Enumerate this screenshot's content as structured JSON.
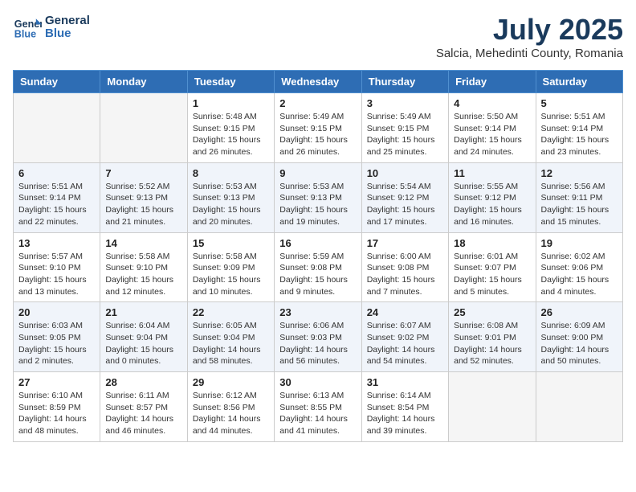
{
  "header": {
    "logo_line1": "General",
    "logo_line2": "Blue",
    "month": "July 2025",
    "location": "Salcia, Mehedinti County, Romania"
  },
  "weekdays": [
    "Sunday",
    "Monday",
    "Tuesday",
    "Wednesday",
    "Thursday",
    "Friday",
    "Saturday"
  ],
  "weeks": [
    [
      {
        "day": "",
        "sunrise": "",
        "sunset": "",
        "daylight": ""
      },
      {
        "day": "",
        "sunrise": "",
        "sunset": "",
        "daylight": ""
      },
      {
        "day": "1",
        "sunrise": "Sunrise: 5:48 AM",
        "sunset": "Sunset: 9:15 PM",
        "daylight": "Daylight: 15 hours and 26 minutes."
      },
      {
        "day": "2",
        "sunrise": "Sunrise: 5:49 AM",
        "sunset": "Sunset: 9:15 PM",
        "daylight": "Daylight: 15 hours and 26 minutes."
      },
      {
        "day": "3",
        "sunrise": "Sunrise: 5:49 AM",
        "sunset": "Sunset: 9:15 PM",
        "daylight": "Daylight: 15 hours and 25 minutes."
      },
      {
        "day": "4",
        "sunrise": "Sunrise: 5:50 AM",
        "sunset": "Sunset: 9:14 PM",
        "daylight": "Daylight: 15 hours and 24 minutes."
      },
      {
        "day": "5",
        "sunrise": "Sunrise: 5:51 AM",
        "sunset": "Sunset: 9:14 PM",
        "daylight": "Daylight: 15 hours and 23 minutes."
      }
    ],
    [
      {
        "day": "6",
        "sunrise": "Sunrise: 5:51 AM",
        "sunset": "Sunset: 9:14 PM",
        "daylight": "Daylight: 15 hours and 22 minutes."
      },
      {
        "day": "7",
        "sunrise": "Sunrise: 5:52 AM",
        "sunset": "Sunset: 9:13 PM",
        "daylight": "Daylight: 15 hours and 21 minutes."
      },
      {
        "day": "8",
        "sunrise": "Sunrise: 5:53 AM",
        "sunset": "Sunset: 9:13 PM",
        "daylight": "Daylight: 15 hours and 20 minutes."
      },
      {
        "day": "9",
        "sunrise": "Sunrise: 5:53 AM",
        "sunset": "Sunset: 9:13 PM",
        "daylight": "Daylight: 15 hours and 19 minutes."
      },
      {
        "day": "10",
        "sunrise": "Sunrise: 5:54 AM",
        "sunset": "Sunset: 9:12 PM",
        "daylight": "Daylight: 15 hours and 17 minutes."
      },
      {
        "day": "11",
        "sunrise": "Sunrise: 5:55 AM",
        "sunset": "Sunset: 9:12 PM",
        "daylight": "Daylight: 15 hours and 16 minutes."
      },
      {
        "day": "12",
        "sunrise": "Sunrise: 5:56 AM",
        "sunset": "Sunset: 9:11 PM",
        "daylight": "Daylight: 15 hours and 15 minutes."
      }
    ],
    [
      {
        "day": "13",
        "sunrise": "Sunrise: 5:57 AM",
        "sunset": "Sunset: 9:10 PM",
        "daylight": "Daylight: 15 hours and 13 minutes."
      },
      {
        "day": "14",
        "sunrise": "Sunrise: 5:58 AM",
        "sunset": "Sunset: 9:10 PM",
        "daylight": "Daylight: 15 hours and 12 minutes."
      },
      {
        "day": "15",
        "sunrise": "Sunrise: 5:58 AM",
        "sunset": "Sunset: 9:09 PM",
        "daylight": "Daylight: 15 hours and 10 minutes."
      },
      {
        "day": "16",
        "sunrise": "Sunrise: 5:59 AM",
        "sunset": "Sunset: 9:08 PM",
        "daylight": "Daylight: 15 hours and 9 minutes."
      },
      {
        "day": "17",
        "sunrise": "Sunrise: 6:00 AM",
        "sunset": "Sunset: 9:08 PM",
        "daylight": "Daylight: 15 hours and 7 minutes."
      },
      {
        "day": "18",
        "sunrise": "Sunrise: 6:01 AM",
        "sunset": "Sunset: 9:07 PM",
        "daylight": "Daylight: 15 hours and 5 minutes."
      },
      {
        "day": "19",
        "sunrise": "Sunrise: 6:02 AM",
        "sunset": "Sunset: 9:06 PM",
        "daylight": "Daylight: 15 hours and 4 minutes."
      }
    ],
    [
      {
        "day": "20",
        "sunrise": "Sunrise: 6:03 AM",
        "sunset": "Sunset: 9:05 PM",
        "daylight": "Daylight: 15 hours and 2 minutes."
      },
      {
        "day": "21",
        "sunrise": "Sunrise: 6:04 AM",
        "sunset": "Sunset: 9:04 PM",
        "daylight": "Daylight: 15 hours and 0 minutes."
      },
      {
        "day": "22",
        "sunrise": "Sunrise: 6:05 AM",
        "sunset": "Sunset: 9:04 PM",
        "daylight": "Daylight: 14 hours and 58 minutes."
      },
      {
        "day": "23",
        "sunrise": "Sunrise: 6:06 AM",
        "sunset": "Sunset: 9:03 PM",
        "daylight": "Daylight: 14 hours and 56 minutes."
      },
      {
        "day": "24",
        "sunrise": "Sunrise: 6:07 AM",
        "sunset": "Sunset: 9:02 PM",
        "daylight": "Daylight: 14 hours and 54 minutes."
      },
      {
        "day": "25",
        "sunrise": "Sunrise: 6:08 AM",
        "sunset": "Sunset: 9:01 PM",
        "daylight": "Daylight: 14 hours and 52 minutes."
      },
      {
        "day": "26",
        "sunrise": "Sunrise: 6:09 AM",
        "sunset": "Sunset: 9:00 PM",
        "daylight": "Daylight: 14 hours and 50 minutes."
      }
    ],
    [
      {
        "day": "27",
        "sunrise": "Sunrise: 6:10 AM",
        "sunset": "Sunset: 8:59 PM",
        "daylight": "Daylight: 14 hours and 48 minutes."
      },
      {
        "day": "28",
        "sunrise": "Sunrise: 6:11 AM",
        "sunset": "Sunset: 8:57 PM",
        "daylight": "Daylight: 14 hours and 46 minutes."
      },
      {
        "day": "29",
        "sunrise": "Sunrise: 6:12 AM",
        "sunset": "Sunset: 8:56 PM",
        "daylight": "Daylight: 14 hours and 44 minutes."
      },
      {
        "day": "30",
        "sunrise": "Sunrise: 6:13 AM",
        "sunset": "Sunset: 8:55 PM",
        "daylight": "Daylight: 14 hours and 41 minutes."
      },
      {
        "day": "31",
        "sunrise": "Sunrise: 6:14 AM",
        "sunset": "Sunset: 8:54 PM",
        "daylight": "Daylight: 14 hours and 39 minutes."
      },
      {
        "day": "",
        "sunrise": "",
        "sunset": "",
        "daylight": ""
      },
      {
        "day": "",
        "sunrise": "",
        "sunset": "",
        "daylight": ""
      }
    ]
  ]
}
